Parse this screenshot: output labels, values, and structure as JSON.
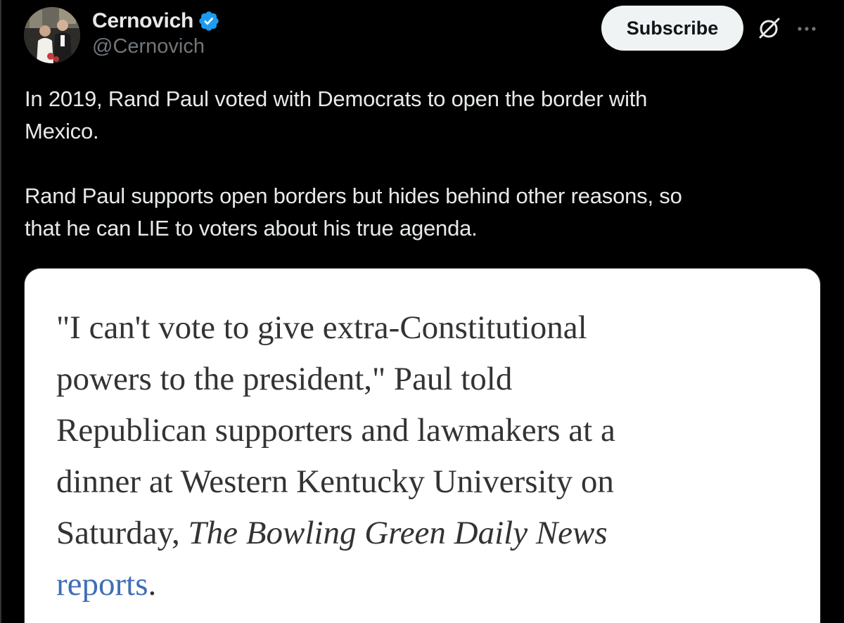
{
  "author": {
    "display_name": "Cernovich",
    "handle": "@Cernovich",
    "verified": true,
    "avatar_icon": "profile-avatar-photo"
  },
  "actions": {
    "subscribe_label": "Subscribe",
    "grok_icon": "grok-icon",
    "more_icon": "more-icon"
  },
  "tweet": {
    "paragraphs": [
      "In 2019, Rand Paul voted with Democrats to open the border with\nMexico.",
      "",
      "Rand Paul supports open borders but hides behind other reasons, so\nthat he can LIE to voters about his true agenda."
    ]
  },
  "media": {
    "quote_text": "\"I can't vote to give extra-Constitutional\npowers to the president,\" Paul told\nRepublican supporters and lawmakers at a\ndinner at Western Kentucky University on\nSaturday, ",
    "publication": "The Bowling Green Daily News",
    "link_text": "reports",
    "trailing": "."
  },
  "colors": {
    "background": "#000000",
    "text_primary": "#e7e9ea",
    "text_secondary": "#71767b",
    "verified_blue": "#1d9bf0",
    "link_blue": "#3f6eb5"
  }
}
